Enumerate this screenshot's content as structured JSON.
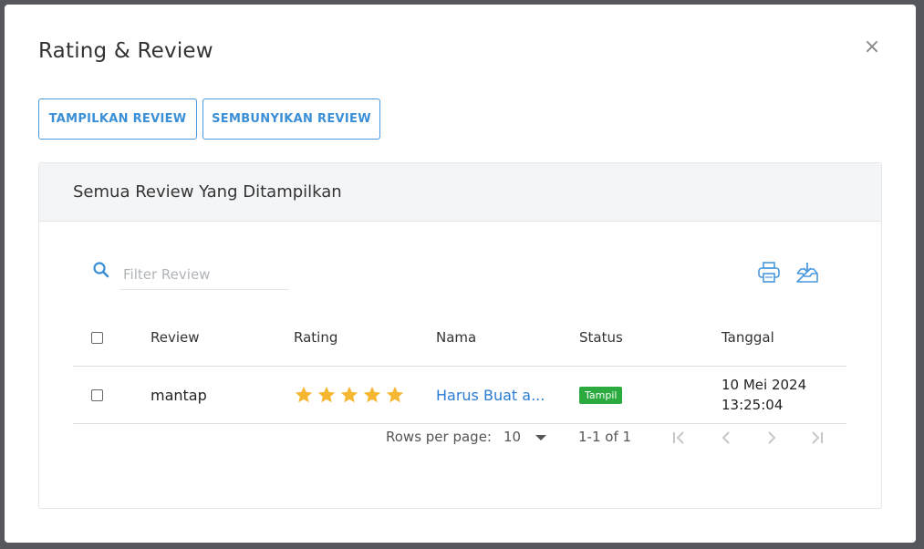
{
  "modal": {
    "title": "Rating & Review",
    "close_label": "×"
  },
  "actions": {
    "show_review": "TAMPILKAN REVIEW",
    "hide_review": "SEMBUNYIKAN REVIEW"
  },
  "card": {
    "header": "Semua Review Yang Ditampilkan"
  },
  "search": {
    "placeholder": "Filter Review",
    "value": ""
  },
  "table": {
    "columns": [
      "Review",
      "Rating",
      "Nama",
      "Status",
      "Tanggal"
    ],
    "rows": [
      {
        "review": "mantap",
        "rating": 5,
        "nama": "Harus Buat a...",
        "status": "Tampil",
        "tanggal_date": "10 Mei 2024",
        "tanggal_time": "13:25:04"
      }
    ]
  },
  "pagination": {
    "rows_per_page_label": "Rows per page:",
    "rows_per_page": "10",
    "range": "1-1 of 1"
  },
  "icons": {
    "search": "search-icon",
    "print": "print-icon",
    "download": "download-icon",
    "star": "star-icon",
    "first": "first-page-icon",
    "prev": "previous-page-icon",
    "next": "next-page-icon",
    "last": "last-page-icon"
  },
  "colors": {
    "accent": "#3a8fd6",
    "star": "#f5b731",
    "status": "#2bab3f",
    "link": "#2a7bd4"
  }
}
